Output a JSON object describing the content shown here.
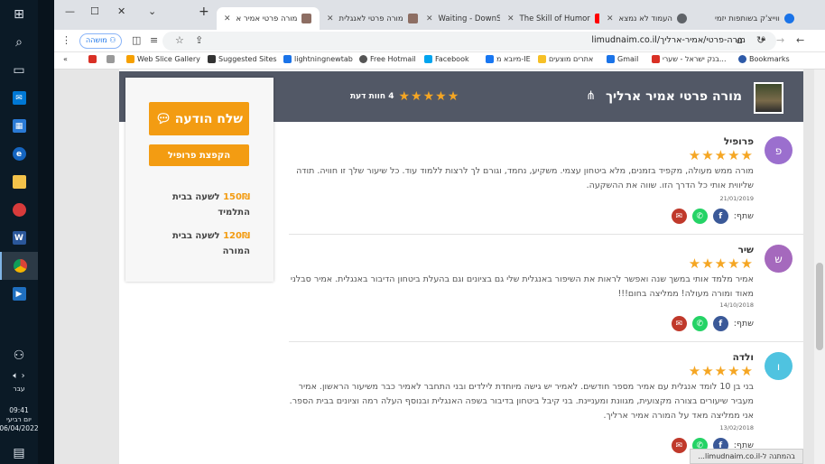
{
  "taskbar": {
    "lang": "עבר",
    "time": "09:41",
    "day": "יום רביעי",
    "date": "06/04/2022"
  },
  "tabs": [
    {
      "label": "ווייצ'ק בשותפות יזמי",
      "color": "#1a73e8"
    },
    {
      "label": "העמוד לא נמצא",
      "color": "#5f6368"
    },
    {
      "label": "The Skill of Humor",
      "color": "#ff0000"
    },
    {
      "label": "Waiting - DownSub",
      "color": "#555555"
    },
    {
      "label": "מורה פרטי לאנגלית",
      "color": "#8d6e63"
    },
    {
      "label": "מורה פרטי אמיר א",
      "color": "#8d6e63"
    }
  ],
  "toolbar": {
    "url": "limudnaim.co.il/מורה-פרטי/אמיר-ארליך",
    "paused_label": "מושהה"
  },
  "bookmarks": [
    {
      "label": "Bookmarks",
      "color": "#f6c026"
    },
    {
      "label": "בנק ישראל - שערי...",
      "color": "#2e5aa8"
    },
    {
      "label": "Gmail",
      "color": "#d93025"
    },
    {
      "label": "אתרים מוצעים",
      "color": "#1a73e8"
    },
    {
      "label": "מיובא מ-IE",
      "color": "#f6c026"
    },
    {
      "label": "Facebook",
      "color": "#1877f2"
    },
    {
      "label": "Free Hotmail",
      "color": "#00a4ef"
    },
    {
      "label": "lightningnewtab",
      "color": "#555555"
    },
    {
      "label": "Suggested Sites",
      "color": "#1a73e8"
    },
    {
      "label": "Web Slice Gallery",
      "color": "#333333"
    }
  ],
  "profile": {
    "name": "מורה פרטי אמיר ארליך",
    "rating_text": "4 חוות דעת",
    "stars": "★★★★★"
  },
  "side": {
    "send_label": "שלח הודעה",
    "profile_label": "הקפצת פרופיל",
    "price1_amount": "150₪",
    "price1_text": "לשעה בבית התלמיד",
    "price2_amount": "120₪",
    "price2_text": "לשעה בבית המורה"
  },
  "share_label": "שתף:",
  "reviews": [
    {
      "initial": "פ",
      "name": "פרופיל",
      "stars": "★★★★★",
      "text": "מורה ממש מעולה, מקפיד בזמנים, מלא ביטחון עצמי. משקיע, נחמד, וגורם לך לרצות ללמוד עוד. כל שיעור שלך זו חוויה. תודה שליווית אותי כל הדרך הזו. שווה את ההשקעה.",
      "date": "21/01/2019",
      "color": "#9b6fce"
    },
    {
      "initial": "ש",
      "name": "שיר",
      "stars": "★★★★★",
      "text": "אמיר מלמד אותי במשך שנה ואפשר לראות את השיפור באנגלית שלי גם בציונים וגם בהעלת ביטחון הדיבור באנגלית. אמיר סבלני מאוד ומורה מעולה! ממליצה בחום!!!",
      "date": "14/10/2018",
      "color": "#a569bd"
    },
    {
      "initial": "ו",
      "name": "ולדה",
      "stars": "★★★★★",
      "text": "בני בן 10 לומד אנגלית עם אמיר מספר חודשים. לאמיר יש גישה מיוחדת לילדים ובני התחבר לאמיר כבר משיעור הראשון. אמיר מעביר שיעורים בצורה מקצועית, מגוונת ומעניינת. בני קיבל ביטחון בדיבור בשפה האנגלית ובנוסף העלה רמה וציונים בבית הספר. אני ממליצה מאד על המורה אמיר ארליך.",
      "date": "13/02/2018",
      "color": "#4fc3e0"
    }
  ],
  "status": "בהמתנה ל-limudnaim.co.il..."
}
